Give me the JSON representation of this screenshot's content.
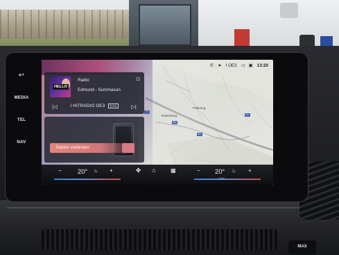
{
  "hard_keys": {
    "back": "↩",
    "media": "MEDIA",
    "tel": "TEL",
    "nav": "NAV"
  },
  "status_bar": {
    "icons": [
      "phone-icon",
      "location-arrow-icon",
      "volume-icon",
      "message-icon"
    ],
    "station": "I OE3",
    "time": "13:20"
  },
  "media": {
    "album_art_text": "HELLO",
    "source": "Radio",
    "track": "Edmund - Summasun",
    "station": "I HITRADIO OE3",
    "badge": "DAB"
  },
  "phone": {
    "connect_label": "Telefon verbinden"
  },
  "map": {
    "labels": [
      "Pöbering",
      "Rosenberg",
      "Rechenberg"
    ],
    "shields": [
      "A1",
      "A1",
      "A1",
      "1"
    ]
  },
  "climate": {
    "left_temp": "20°",
    "right_temp": "20°",
    "minus": "−",
    "plus": "+",
    "sync": "SYNC"
  },
  "dashboard": {
    "max_button": "MAX"
  }
}
